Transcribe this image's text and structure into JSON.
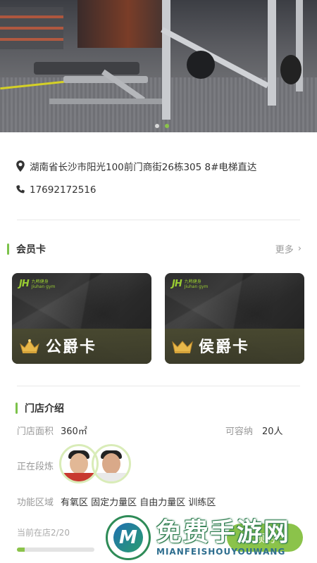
{
  "hero": {
    "dots": 2,
    "active_dot": 2
  },
  "info": {
    "address": "湖南省长沙市阳光100前门商街26栋305 8#电梯直达",
    "phone": "17692172516"
  },
  "membership": {
    "title": "会员卡",
    "more": "更多",
    "cards": [
      {
        "name": "公爵卡",
        "brand": "九韩健身",
        "brand_sub": "Jiuhan gym"
      },
      {
        "name": "侯爵卡",
        "brand": "九韩健身",
        "brand_sub": "Jiuhan gym"
      }
    ]
  },
  "store": {
    "title": "门店介绍",
    "area_label": "门店面积",
    "area_value": "360㎡",
    "capacity_label": "可容纳",
    "capacity_value": "20人",
    "training_label": "正在段炼",
    "zones_label": "功能区域",
    "zones_value": "有氧区  固定力量区  自由力量区  训练区",
    "occupancy_label": "当前在店2/20",
    "occupancy_fraction": 0.1,
    "cta_label": "预约"
  },
  "watermark": {
    "title": "免费手游网",
    "subtitle": "MIANFEISHOUYOUWANG"
  },
  "colors": {
    "accent": "#8bc34a",
    "section_bar": "#7cc24a"
  }
}
